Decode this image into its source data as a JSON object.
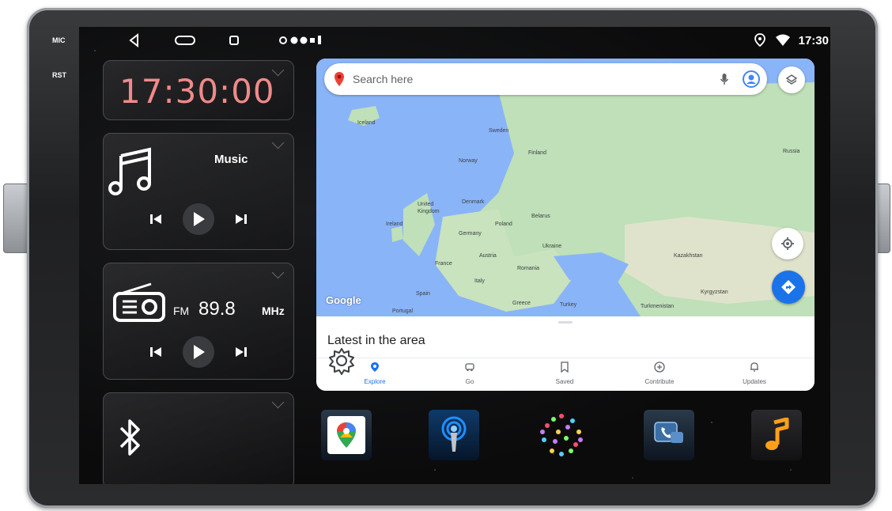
{
  "hardware": {
    "mic_label": "MIC",
    "rst_label": "RST"
  },
  "statusbar": {
    "time": "17:30"
  },
  "clock_widget": {
    "time": "17:30:00"
  },
  "music_widget": {
    "title": "Music"
  },
  "radio_widget": {
    "band": "FM",
    "frequency": "89.8",
    "unit": "MHz"
  },
  "map": {
    "search_placeholder": "Search here",
    "logo": "Google",
    "countries": [
      "Iceland",
      "Sweden",
      "Finland",
      "Norway",
      "Russia",
      "Denmark",
      "United Kingdom",
      "Ireland",
      "Belarus",
      "Germany",
      "Poland",
      "Ukraine",
      "Austria",
      "France",
      "Romania",
      "Kazakhstan",
      "Italy",
      "Spain",
      "Portugal",
      "Greece",
      "Turkey",
      "Turkmenistan",
      "Kyrgyzstan"
    ],
    "sheet_title": "Latest in the area",
    "nav": [
      {
        "label": "Explore",
        "icon": "pin-icon",
        "active": true
      },
      {
        "label": "Go",
        "icon": "car-icon",
        "active": false
      },
      {
        "label": "Saved",
        "icon": "bookmark-icon",
        "active": false
      },
      {
        "label": "Contribute",
        "icon": "plus-circle-icon",
        "active": false
      },
      {
        "label": "Updates",
        "icon": "bell-icon",
        "active": false
      }
    ]
  },
  "dock": [
    {
      "name": "maps-app",
      "icon": "google-maps-icon"
    },
    {
      "name": "podcast-app",
      "icon": "microphone-icon"
    },
    {
      "name": "apps-app",
      "icon": "dots-circle-icon"
    },
    {
      "name": "phone-app",
      "icon": "phone-icon"
    },
    {
      "name": "music-app",
      "icon": "music-note-icon"
    }
  ],
  "colors": {
    "clock": "#f08a8a",
    "map_water": "#8ab4f8",
    "map_land": "#bfe0b8",
    "accent": "#1a73e8"
  }
}
